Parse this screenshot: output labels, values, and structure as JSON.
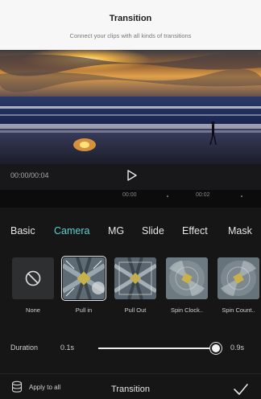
{
  "header": {
    "title": "Transition",
    "subtitle": "Connect your clips with all kinds of transitions"
  },
  "player": {
    "timecode": "00:00/00:04",
    "play_icon": "play-icon"
  },
  "ruler": {
    "marks": [
      "00:00",
      "00:02"
    ]
  },
  "tabs": [
    {
      "label": "Basic",
      "active": false
    },
    {
      "label": "Camera",
      "active": true
    },
    {
      "label": "MG",
      "active": false
    },
    {
      "label": "Slide",
      "active": false
    },
    {
      "label": "Effect",
      "active": false
    },
    {
      "label": "Mask",
      "active": false
    }
  ],
  "transitions": [
    {
      "label": "None",
      "icon": "none-icon",
      "selected": false
    },
    {
      "label": "Pull in",
      "icon": "pull-in-thumb",
      "selected": true
    },
    {
      "label": "Pull Out",
      "icon": "pull-out-thumb",
      "selected": false
    },
    {
      "label": "Spin Clock..",
      "icon": "spin-clockwise-thumb",
      "selected": false
    },
    {
      "label": "Spin Count..",
      "icon": "spin-counterclockwise-thumb",
      "selected": false
    }
  ],
  "duration": {
    "label": "Duration",
    "min": "0.1s",
    "max": "0.9s",
    "value_fraction": 1.0
  },
  "bottom_bar": {
    "apply_label": "Apply to all",
    "title": "Transition",
    "apply_icon": "layers-icon",
    "confirm_icon": "check-icon"
  },
  "colors": {
    "accent": "#5ccfd1",
    "panel_bg": "#161617",
    "header_bg": "#f7f7f7"
  }
}
